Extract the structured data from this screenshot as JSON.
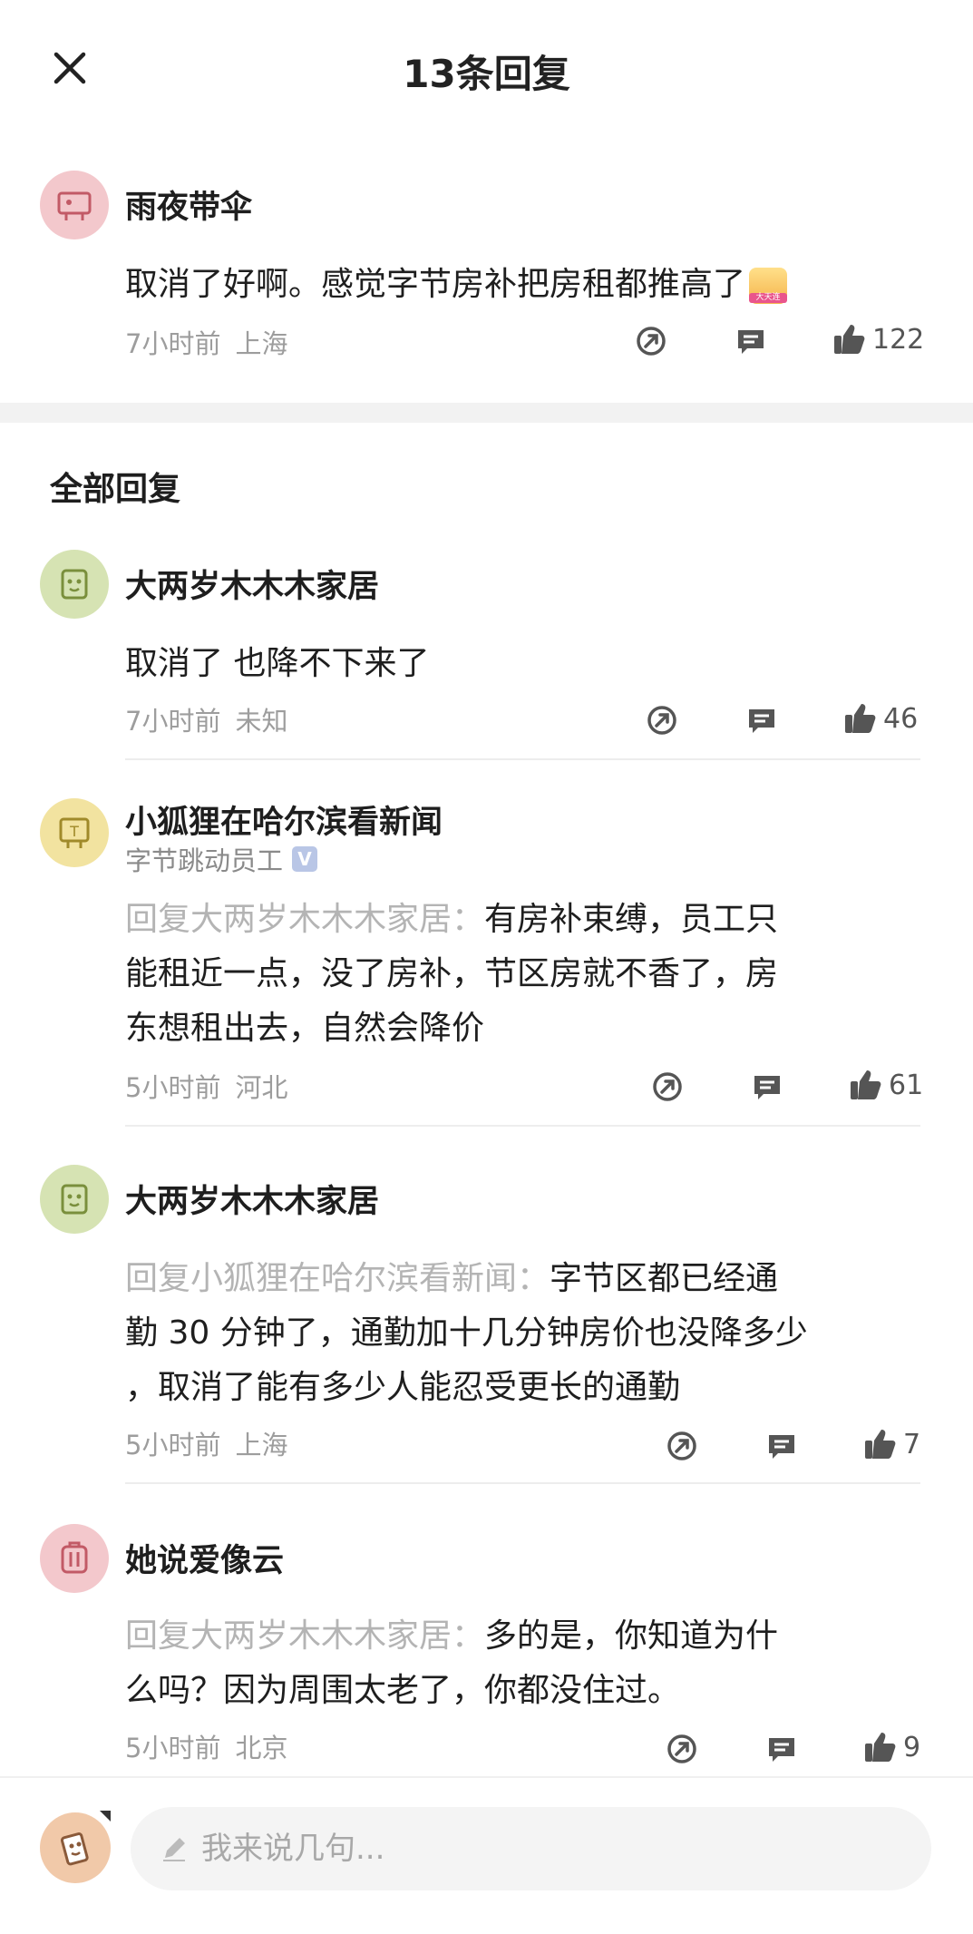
{
  "header": {
    "title": "13条回复"
  },
  "main_comment": {
    "username": "雨夜带伞",
    "text": "取消了好啊。感觉字节房补把房租都推高了",
    "emoji_label": "大天连",
    "time": "7小时前",
    "location": "上海",
    "likes": "122"
  },
  "section_title": "全部回复",
  "replies": [
    {
      "username": "大两岁木木木家居",
      "text": "取消了 也降不下来了",
      "time": "7小时前",
      "location": "未知",
      "likes": "46"
    },
    {
      "username": "小狐狸在哈尔滨看新闻",
      "badge": "字节跳动员工",
      "verified_mark": "V",
      "reply_to": "回复大两岁木木木家居：",
      "line1": "有房补束缚，员工只",
      "line2": "能租近一点，没了房补，节区房就不香了，房",
      "line3": "东想租出去，自然会降价",
      "time": "5小时前",
      "location": "河北",
      "likes": "61"
    },
    {
      "username": "大两岁木木木家居",
      "reply_to": "回复小狐狸在哈尔滨看新闻：",
      "line1": "字节区都已经通",
      "line2": "勤 30 分钟了，通勤加十几分钟房价也没降多少",
      "line3": "，取消了能有多少人能忍受更长的通勤",
      "time": "5小时前",
      "location": "上海",
      "likes": "7"
    },
    {
      "username": "她说爱像云",
      "reply_to": "回复大两岁木木木家居：",
      "line1": "多的是，你知道为什",
      "line2": "么吗？因为周围太老了，你都没住过。",
      "time": "5小时前",
      "location": "北京",
      "likes": "9"
    }
  ],
  "composer": {
    "placeholder": "我来说几句..."
  },
  "colors": {
    "avatar_pink": "#f3c8cc",
    "avatar_green": "#d6e3b3",
    "avatar_yellow": "#f2e3a0",
    "avatar_orange": "#f1c9a9",
    "reply_prefix": "#b4b4b4"
  },
  "icons": [
    "close-icon",
    "share-icon",
    "comment-icon",
    "thumbs-up-icon",
    "pen-icon"
  ]
}
